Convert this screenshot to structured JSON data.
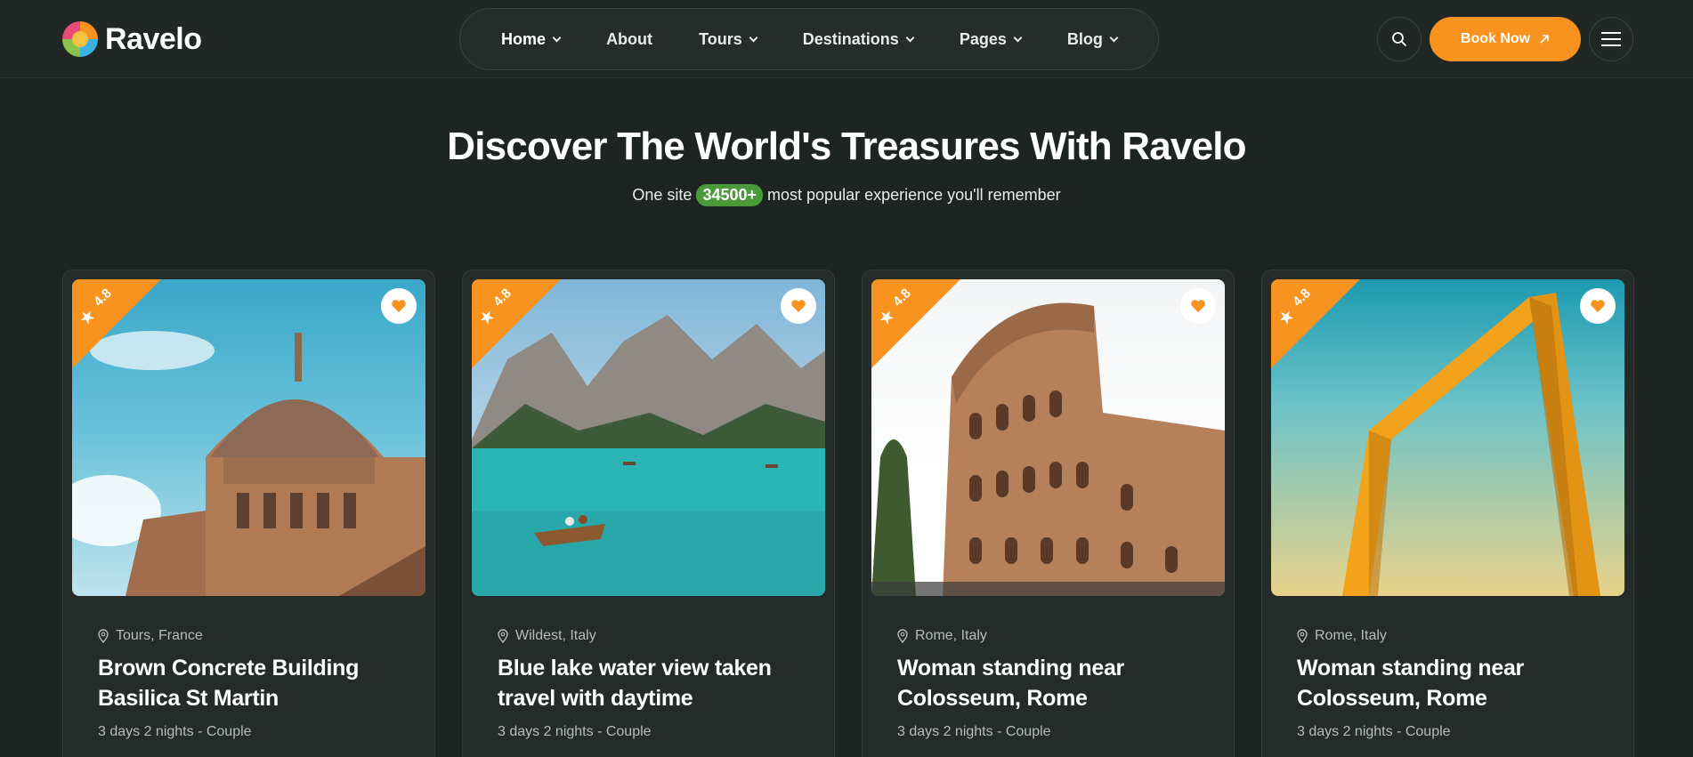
{
  "brand": {
    "name": "Ravelo"
  },
  "nav": {
    "items": [
      {
        "label": "Home",
        "has_dropdown": true
      },
      {
        "label": "About",
        "has_dropdown": false
      },
      {
        "label": "Tours",
        "has_dropdown": true
      },
      {
        "label": "Destinations",
        "has_dropdown": true
      },
      {
        "label": "Pages",
        "has_dropdown": true
      },
      {
        "label": "Blog",
        "has_dropdown": true
      }
    ]
  },
  "header_actions": {
    "search_icon": "search-icon",
    "book_label": "Book Now",
    "menu_icon": "hamburger-icon"
  },
  "hero": {
    "title": "Discover The World's Treasures With Ravelo",
    "sub_before": "One site",
    "sub_count": "34500+",
    "sub_after": "most popular experience you'll remember"
  },
  "colors": {
    "accent": "#f7931e",
    "badge_green": "#4a9a3a",
    "background": "#1e2421"
  },
  "cards": [
    {
      "rating": "4.8",
      "location": "Tours, France",
      "title": "Brown Concrete Building Basilica St Martin",
      "meta": "3 days 2 nights - Couple"
    },
    {
      "rating": "4.8",
      "location": "Wildest, Italy",
      "title": "Blue lake water view taken travel with daytime",
      "meta": "3 days 2 nights - Couple"
    },
    {
      "rating": "4.8",
      "location": "Rome, Italy",
      "title": "Woman standing near Colosseum, Rome",
      "meta": "3 days 2 nights - Couple"
    },
    {
      "rating": "4.8",
      "location": "Rome, Italy",
      "title": "Woman standing near Colosseum, Rome",
      "meta": "3 days 2 nights - Couple"
    }
  ]
}
